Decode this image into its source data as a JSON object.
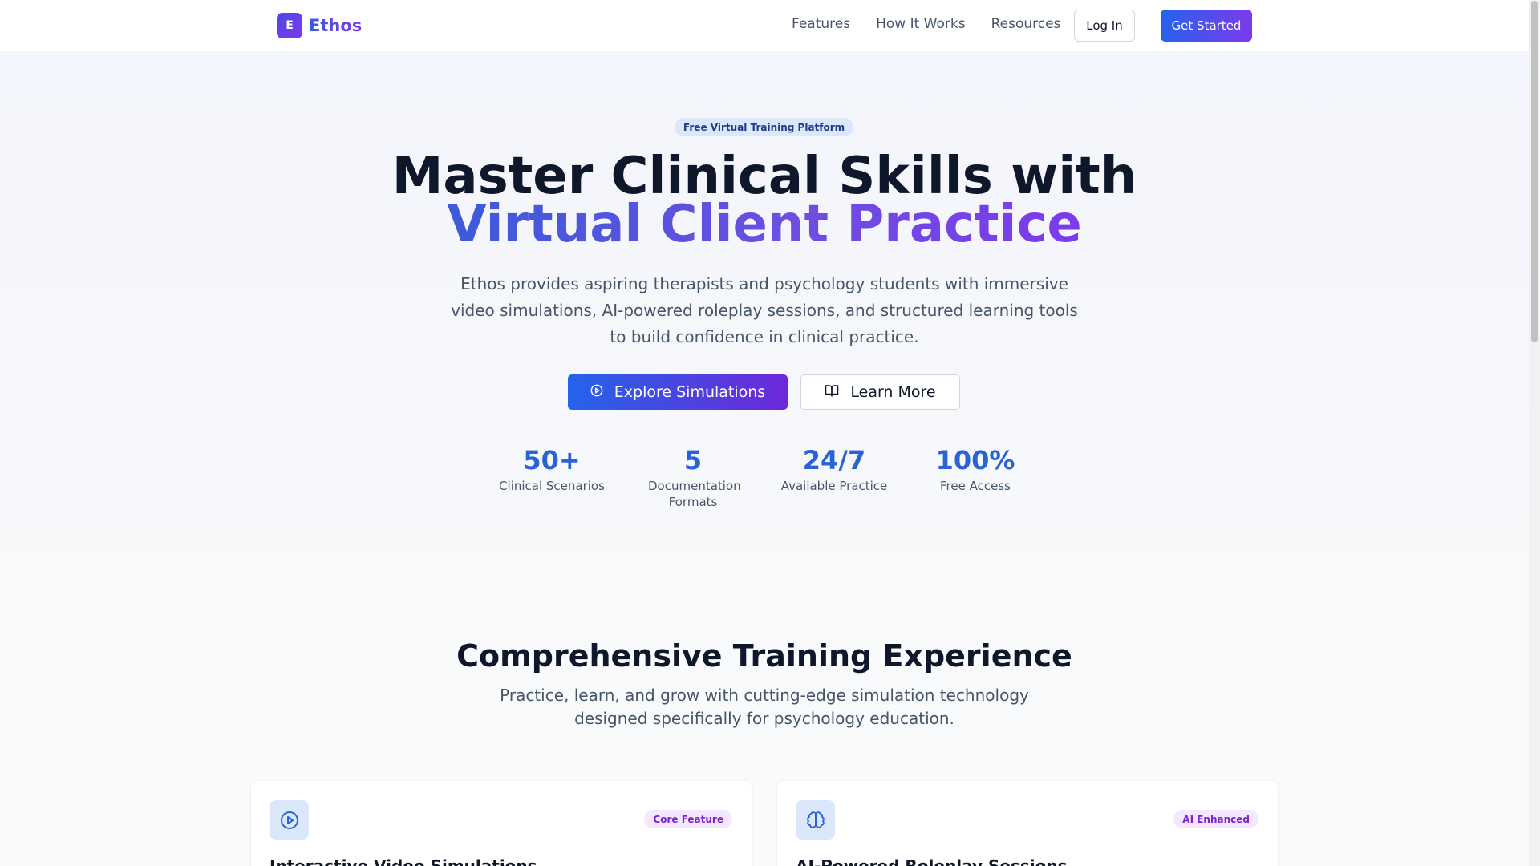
{
  "nav": {
    "brand_initial": "E",
    "brand_name": "Ethos",
    "links": [
      "Features",
      "How It Works",
      "Resources"
    ],
    "login_label": "Log In",
    "get_started_label": "Get Started"
  },
  "hero": {
    "badge": "Free Virtual Training Platform",
    "title_line1": "Master Clinical Skills with",
    "title_line2": "Virtual Client Practice",
    "lead": "Ethos provides aspiring therapists and psychology students with immersive video simulations, AI-powered roleplay sessions, and structured learning tools to build confidence in clinical practice.",
    "explore_label": "Explore Simulations",
    "learn_label": "Learn More",
    "stats": [
      {
        "value": "50+",
        "label": "Clinical Scenarios"
      },
      {
        "value": "5",
        "label": "Documentation Formats"
      },
      {
        "value": "24/7",
        "label": "Available Practice"
      },
      {
        "value": "100%",
        "label": "Free Access"
      }
    ]
  },
  "features": {
    "title": "Comprehensive Training Experience",
    "subtitle": "Practice, learn, and grow with cutting-edge simulation technology designed specifically for psychology education.",
    "cards": [
      {
        "badge": "Core Feature",
        "title": "Interactive Video Simulations",
        "icon": "play-circle-icon"
      },
      {
        "badge": "AI Enhanced",
        "title": "AI-Powered Roleplay Sessions",
        "icon": "brain-icon"
      }
    ]
  },
  "colors": {
    "accent_blue": "#2563eb",
    "accent_purple": "#7c3aed",
    "stat_blue": "#2a62d8"
  }
}
